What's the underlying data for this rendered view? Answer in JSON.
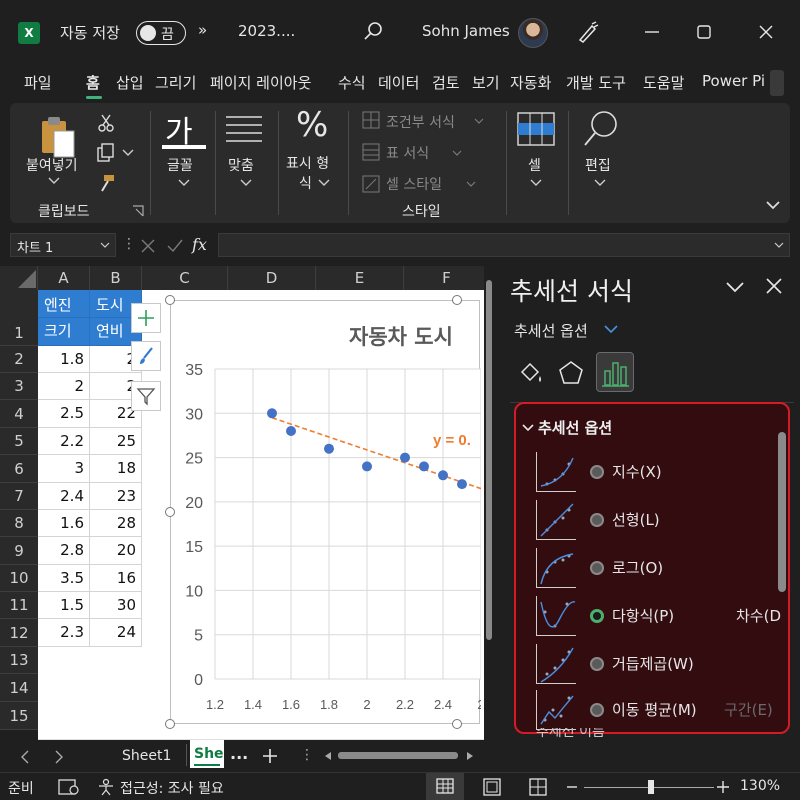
{
  "titlebar": {
    "autosave_label": "자동 저장",
    "toggle_state": "끔",
    "more": "»",
    "filename": "2023....",
    "user_name": "Sohn James"
  },
  "ribbon_tabs": [
    "파일",
    "홈",
    "삽입",
    "그리기",
    "페이지 레이아웃",
    "수식",
    "데이터",
    "검토",
    "보기",
    "자동화",
    "개발 도구",
    "도움말",
    "Power Pi"
  ],
  "active_tab": "홈",
  "ribbon": {
    "paste_label": "붙여넣기",
    "clipboard_group": "클립보드",
    "font_glyph": "가",
    "font_label": "글꼴",
    "align_label": "맞춤",
    "number_glyph": "%",
    "number_label_1": "표시 형",
    "number_label_2": "식",
    "cond_format": "조건부 서식",
    "table_format": "표 서식",
    "cell_style": "셀 스타일",
    "styles_group": "스타일",
    "cells_label": "셀",
    "edit_label": "편집"
  },
  "formula_bar": {
    "name_box": "차트 1",
    "fx": "fx",
    "formula": ""
  },
  "grid": {
    "columns": [
      "A",
      "B",
      "C",
      "D",
      "E",
      "F"
    ],
    "rows": [
      "1",
      "2",
      "3",
      "4",
      "5",
      "6",
      "7",
      "8",
      "9",
      "10",
      "11",
      "12",
      "13",
      "14",
      "15"
    ],
    "header_a_1": "엔진",
    "header_a_2": "크기",
    "header_b_1": "도시",
    "header_b_2": "연비",
    "col_a": [
      "1.8",
      "2",
      "2.5",
      "2.2",
      "3",
      "2.4",
      "1.6",
      "2.8",
      "3.5",
      "1.5",
      "2.3"
    ],
    "col_b": [
      "2",
      "2",
      "22",
      "25",
      "18",
      "23",
      "28",
      "20",
      "16",
      "30",
      "24"
    ]
  },
  "chart_data": {
    "type": "scatter",
    "title": "자동차 도시",
    "points": [
      {
        "x": 1.5,
        "y": 30
      },
      {
        "x": 1.6,
        "y": 28
      },
      {
        "x": 1.8,
        "y": 26
      },
      {
        "x": 2.0,
        "y": 24
      },
      {
        "x": 2.2,
        "y": 25
      },
      {
        "x": 2.3,
        "y": 24
      },
      {
        "x": 2.4,
        "y": 23
      },
      {
        "x": 2.5,
        "y": 22
      }
    ],
    "trendline": {
      "x0": 1.5,
      "y0": 29.5,
      "x1": 2.6,
      "y1": 21.5,
      "label": "y = 0."
    },
    "x_ticks": [
      "1.2",
      "1.4",
      "1.6",
      "1.8",
      "2",
      "2.2",
      "2.4",
      "2"
    ],
    "y_ticks": [
      "35",
      "30",
      "25",
      "20",
      "15",
      "10",
      "5",
      "0"
    ],
    "xlim": [
      1.2,
      2.6
    ],
    "ylim": [
      0,
      35
    ],
    "grid": true,
    "colors": {
      "points": "#4472c4",
      "trend": "#ed7d31"
    }
  },
  "pane": {
    "title": "추세선 서식",
    "subtitle": "추세선 옵션",
    "section": "추세선 옵션",
    "options": [
      {
        "label": "지수(X)",
        "selected": false
      },
      {
        "label": "선형(L)",
        "selected": false
      },
      {
        "label": "로그(O)",
        "selected": false
      },
      {
        "label": "다항식(P)",
        "selected": true,
        "extra": "차수(D"
      },
      {
        "label": "거듭제곱(W)",
        "selected": false
      },
      {
        "label": "이동 평균(M)",
        "selected": false,
        "extra": "구간(E)"
      }
    ],
    "footer_cut": "추세선 이름"
  },
  "sheets": {
    "tab1": "Sheet1",
    "tab2": "She",
    "more": "..."
  },
  "status": {
    "ready": "준비",
    "accessibility": "접근성: 조사 필요",
    "zoom": "130%"
  },
  "colors": {
    "accent_green": "#3fb27f",
    "header_blue": "#2f7dd1",
    "pane_highlight": "#d51c26"
  }
}
